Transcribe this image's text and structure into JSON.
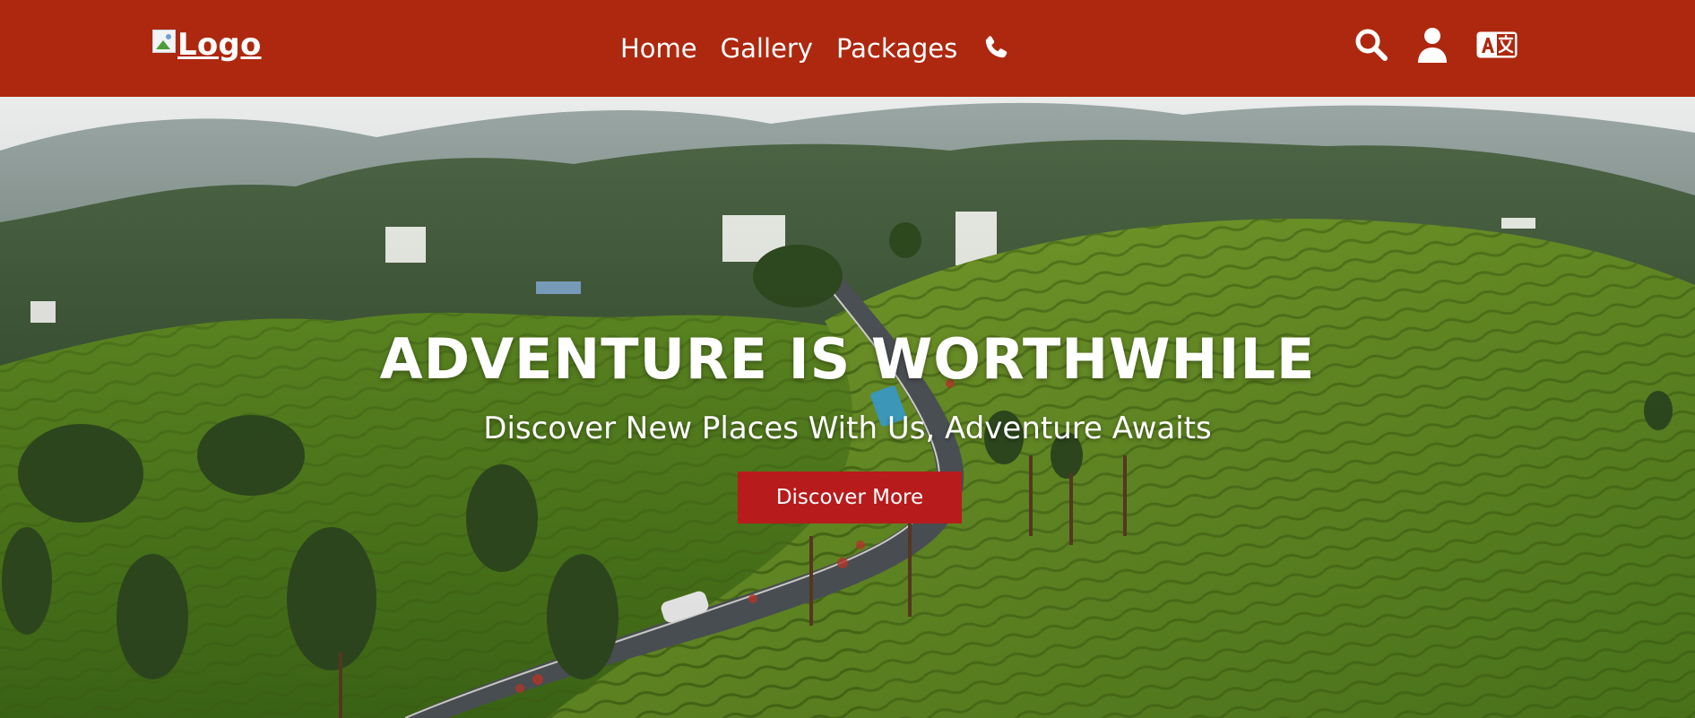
{
  "header": {
    "logo_text": "Logo",
    "nav": [
      {
        "label": "Home"
      },
      {
        "label": "Gallery"
      },
      {
        "label": "Packages"
      }
    ],
    "icons": [
      "phone-icon",
      "search-icon",
      "user-icon",
      "language-icon"
    ]
  },
  "hero": {
    "title": "ADVENTURE IS WORTHWHILE",
    "subtitle": "Discover New Places With Us, Adventure Awaits",
    "cta_label": "Discover More"
  },
  "colors": {
    "navbar": "#ad280f",
    "cta": "#b71b1c",
    "text": "#ffffff"
  }
}
